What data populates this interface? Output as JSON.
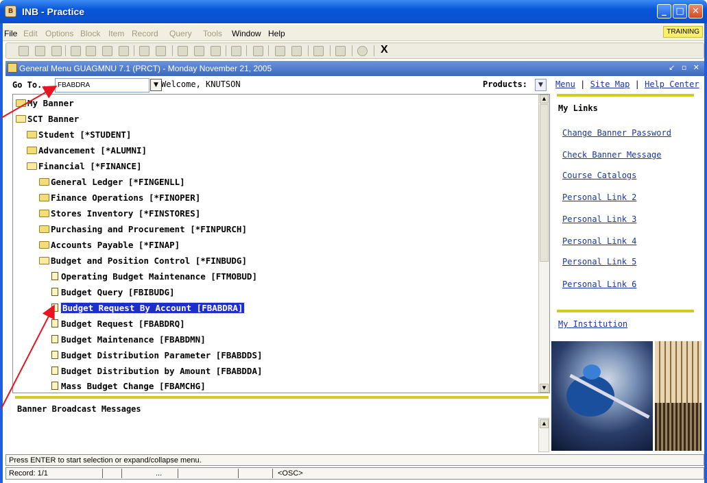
{
  "window": {
    "title": "INB - Practice",
    "app_icon": "banner-app-icon"
  },
  "menu": {
    "items": [
      {
        "label": "File",
        "enabled": true
      },
      {
        "label": "Edit",
        "enabled": false
      },
      {
        "label": "Options",
        "enabled": false
      },
      {
        "label": "Block",
        "enabled": false
      },
      {
        "label": "Item",
        "enabled": false
      },
      {
        "label": "Record",
        "enabled": false
      },
      {
        "label": "Query",
        "enabled": false
      },
      {
        "label": "Tools",
        "enabled": false
      },
      {
        "label": "Window",
        "enabled": true
      },
      {
        "label": "Help",
        "enabled": true
      }
    ],
    "badge": "TRAINING"
  },
  "toolbar": {
    "exit_label": "X"
  },
  "form": {
    "title": "General Menu GUAGMNU 7.1 (PRCT) - Monday November 21, 2005",
    "controls": "↙ ▫ ✕"
  },
  "goto": {
    "label": "Go To...",
    "value": "FBABDRA",
    "welcome": "Welcome, KNUTSON",
    "products_label": "Products:"
  },
  "toplinks": {
    "menu": "Menu",
    "sitemap": "Site Map",
    "help": "Help Center",
    "sep": "|"
  },
  "tree": [
    {
      "label": "My Banner",
      "type": "folder"
    },
    {
      "label": "SCT Banner",
      "type": "folder-open"
    },
    {
      "label": "Student [*STUDENT]",
      "type": "folder"
    },
    {
      "label": "Advancement [*ALUMNI]",
      "type": "folder"
    },
    {
      "label": "Financial [*FINANCE]",
      "type": "folder-open"
    },
    {
      "label": "General Ledger [*FINGENLL]",
      "type": "folder"
    },
    {
      "label": "Finance Operations [*FINOPER]",
      "type": "folder"
    },
    {
      "label": "Stores Inventory [*FINSTORES]",
      "type": "folder"
    },
    {
      "label": "Purchasing and Procurement [*FINPURCH]",
      "type": "folder"
    },
    {
      "label": "Accounts Payable [*FINAP]",
      "type": "folder"
    },
    {
      "label": "Budget and Position Control [*FINBUDG]",
      "type": "folder-open"
    },
    {
      "label": "Operating Budget Maintenance [FTMOBUD]",
      "type": "doc"
    },
    {
      "label": "Budget Query [FBIBUDG]",
      "type": "doc"
    },
    {
      "label": "Budget Request By Account [FBABDRA]",
      "type": "doc",
      "selected": true
    },
    {
      "label": "Budget Request [FBABDRQ]",
      "type": "doc"
    },
    {
      "label": "Budget Maintenance [FBABDMN]",
      "type": "doc"
    },
    {
      "label": "Budget Distribution Parameter [FBABDDS]",
      "type": "doc"
    },
    {
      "label": "Budget Distribution by Amount [FBABDDA]",
      "type": "doc"
    },
    {
      "label": "Mass Budget Change [FBAMCHG]",
      "type": "doc"
    }
  ],
  "mylinks": {
    "title": "My Links",
    "links": [
      "Change Banner Password",
      "Check Banner Message",
      "Course Catalogs",
      "Personal Link 2",
      "Personal Link 3",
      "Personal Link 4",
      "Personal Link 5",
      "Personal Link 6"
    ],
    "institution": "My Institution"
  },
  "broadcast": {
    "title": "Banner Broadcast Messages"
  },
  "status": {
    "message": "Press ENTER to start selection or expand/collapse menu.",
    "record": "Record: 1/1",
    "ellipsis": "...",
    "mode": "<OSC>"
  },
  "colors": {
    "selection": "#1c2fc8",
    "link": "#1a34a8",
    "divider": "#cfcc1e",
    "titlebar": "#0857d8",
    "annotation_arrow": "#e8141e"
  }
}
